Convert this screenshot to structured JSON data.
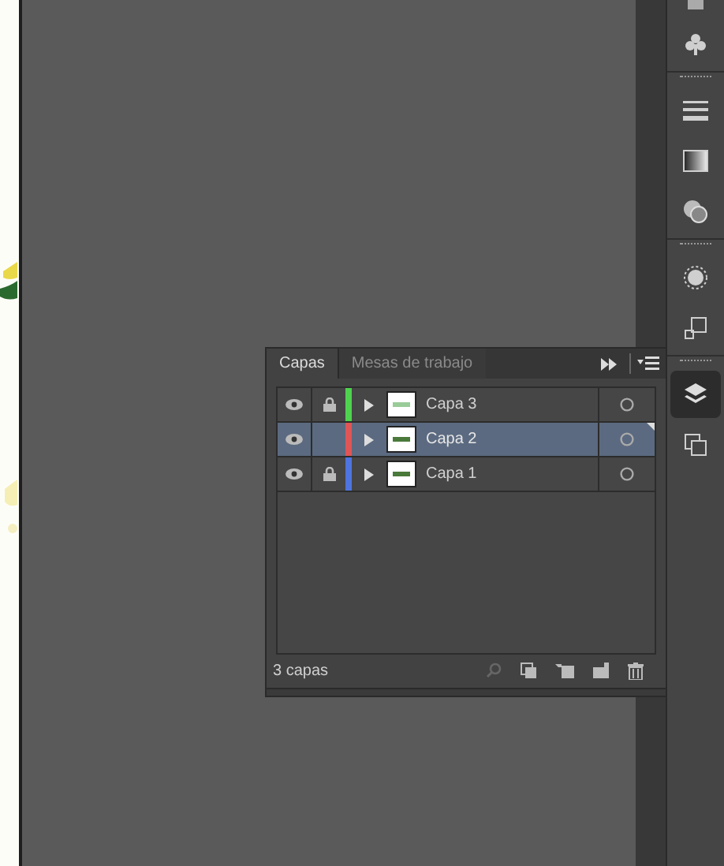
{
  "layers_panel": {
    "tabs": [
      {
        "label": "Capas",
        "selected": true
      },
      {
        "label": "Mesas de trabajo",
        "selected": false
      }
    ],
    "layers": [
      {
        "name": "Capa 3",
        "visible": true,
        "locked": true,
        "color": "#4fd34f",
        "selected": false
      },
      {
        "name": "Capa 2",
        "visible": true,
        "locked": false,
        "color": "#e05555",
        "selected": true
      },
      {
        "name": "Capa 1",
        "visible": true,
        "locked": true,
        "color": "#4f74e0",
        "selected": false
      }
    ],
    "count": "3 capas"
  },
  "tool_strip": {
    "items": [
      {
        "kind": "club",
        "selected": false
      },
      {
        "kind": "sep"
      },
      {
        "kind": "stroke",
        "selected": false
      },
      {
        "kind": "gradient",
        "selected": false
      },
      {
        "kind": "transparency",
        "selected": false
      },
      {
        "kind": "sep"
      },
      {
        "kind": "appearance",
        "selected": false
      },
      {
        "kind": "align",
        "selected": false
      },
      {
        "kind": "sep"
      },
      {
        "kind": "layers",
        "selected": true
      },
      {
        "kind": "artboards",
        "selected": false
      }
    ]
  }
}
